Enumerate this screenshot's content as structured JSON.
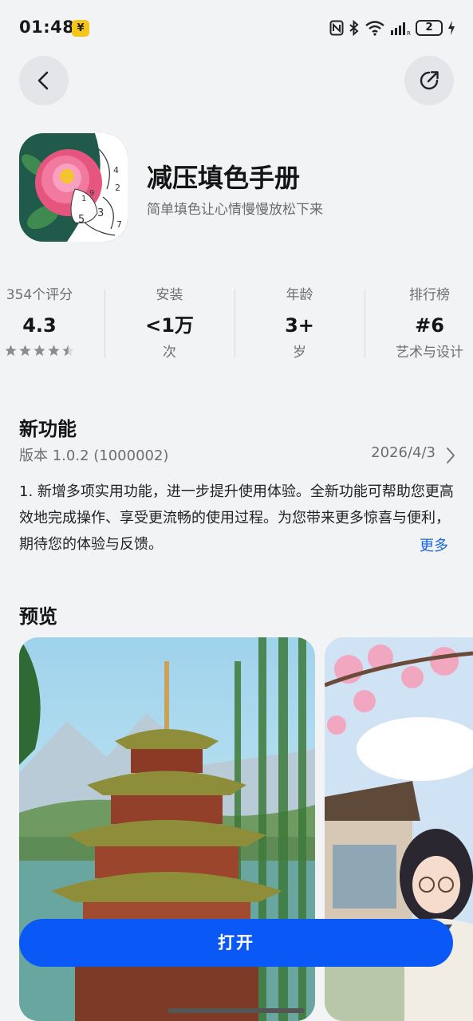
{
  "status_bar": {
    "time": "01:48",
    "yuan_badge": "¥",
    "battery": "2"
  },
  "app": {
    "title": "减压填色手册",
    "subtitle": "简单填色让心情慢慢放松下来"
  },
  "stats": [
    {
      "label": "354个评分",
      "value": "4.3",
      "sub": "",
      "rating_stars": 4.3
    },
    {
      "label": "安装",
      "value": "<1万",
      "sub": "次"
    },
    {
      "label": "年龄",
      "value": "3+",
      "sub": "岁"
    },
    {
      "label": "排行榜",
      "value": "#6",
      "sub": "艺术与设计"
    }
  ],
  "whats_new": {
    "title": "新功能",
    "version": "版本 1.0.2 (1000002)",
    "date": "2026/4/3",
    "description": "1. 新增多项实用功能，进一步提升使用体验。全新功能可帮助您更高效地完成操作、享受更流畅的使用过程。为您带来更多惊喜与便利，期待您的体验与反馈。",
    "more": "更多"
  },
  "preview": {
    "title": "预览"
  },
  "open_button": "打开",
  "colors": {
    "accent": "#0a59f7",
    "link": "#1a66e6",
    "background": "#f1f3f5"
  }
}
